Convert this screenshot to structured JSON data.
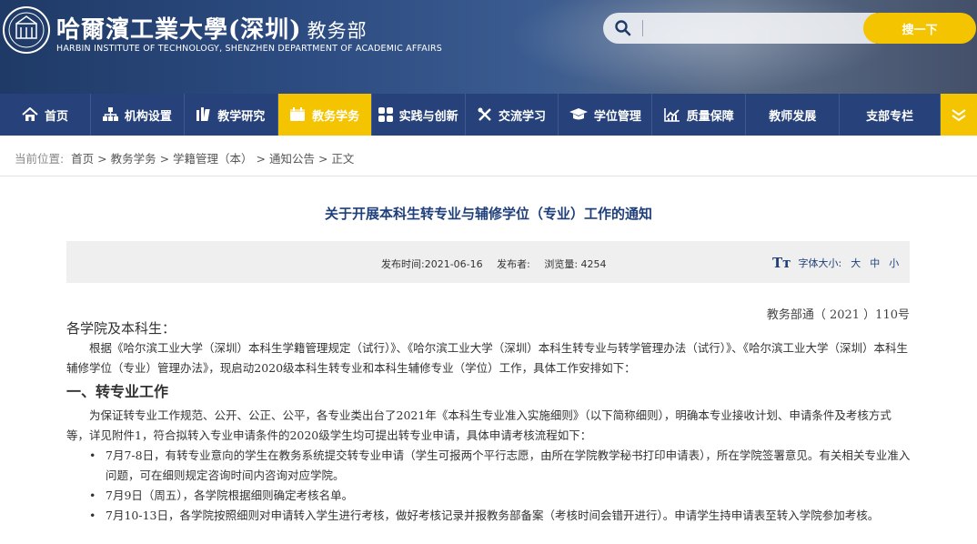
{
  "header": {
    "title_cn": "哈爾濱工業大學(深圳)",
    "dept": "教务部",
    "title_en": "HARBIN INSTITUTE OF TECHNOLOGY, SHENZHEN DEPARTMENT OF ACADEMIC AFFAIRS",
    "logo_icon": "hit-seal-logo"
  },
  "search": {
    "placeholder": "",
    "value": "",
    "button": "搜一下",
    "icon": "search-icon"
  },
  "nav": {
    "items": [
      {
        "label": "首页",
        "icon": "home-icon"
      },
      {
        "label": "机构设置",
        "icon": "org-chart-icon"
      },
      {
        "label": "教学研究",
        "icon": "bars-icon"
      },
      {
        "label": "教务学务",
        "icon": "calendar-icon",
        "active": true
      },
      {
        "label": "实践与创新",
        "icon": "grid-icon"
      },
      {
        "label": "交流学习",
        "icon": "tools-icon"
      },
      {
        "label": "学位管理",
        "icon": "graduation-cap-icon"
      },
      {
        "label": "质量保障",
        "icon": "chart-icon"
      },
      {
        "label": "教师发展",
        "icon": ""
      },
      {
        "label": "支部专栏",
        "icon": ""
      }
    ],
    "more_icon": "chevron-down-icon"
  },
  "breadcrumb": {
    "prefix": "当前位置:",
    "items": [
      "首页",
      "教务学务",
      "学籍管理（本）",
      "通知公告",
      "正文"
    ]
  },
  "article": {
    "title": "关于开展本科生转专业与辅修学位（专业）工作的通知",
    "publish_time": "发布时间:2021-06-16",
    "publisher": "发布者:",
    "views": "浏览量: 4254",
    "font_size_label": "字体大小:",
    "font_sizes": [
      "大",
      "中",
      "小"
    ],
    "font_icon": "Tт",
    "doc_no": "教务部通（ 2021 ）110号",
    "greeting": "各学院及本科生：",
    "intro": "根据《哈尔滨工业大学（深圳）本科生学籍管理规定（试行）》、《哈尔滨工业大学（深圳）本科生转专业与转学管理办法（试行）》、《哈尔滨工业大学（深圳）本科生辅修学位（专业）管理办法》，现启动2020级本科生转专业和本科生辅修专业（学位）工作，具体工作安排如下：",
    "section1": "一、转专业工作",
    "section1_para": "为保证转专业工作规范、公开、公正、公平，各专业类出台了2021年《本科生专业准入实施细则》（以下简称细则），明确本专业接收计划、申请条件及考核方式等，详见附件1，符合拟转入专业申请条件的2020级学生均可提出转专业申请，具体申请考核流程如下：",
    "steps": [
      "7月7-8日，有转专业意向的学生在教务系统提交转专业申请（学生可报两个平行志愿，由所在学院教学秘书打印申请表），所在学院签署意见。有关相关专业准入问题，可在细则规定咨询时间内咨询对应学院。",
      "7月9日（周五），各学院根据细则确定考核名单。",
      "7月10-13日，各学院按照细则对申请转入学生进行考核，做好考核记录并报教务部备案（考核时间会错开进行）。申请学生持申请表至转入学院参加考核。"
    ]
  },
  "colors": {
    "nav_bg": "#27427a",
    "accent": "#f5c400",
    "title": "#1f3f7a"
  }
}
